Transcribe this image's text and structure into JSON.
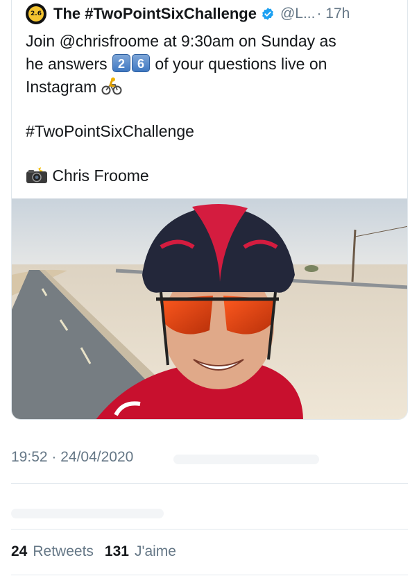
{
  "tweet": {
    "avatar_text": "2.6",
    "display_name": "The #TwoPointSixChallenge",
    "handle": "@L...",
    "time": "· 17h",
    "text": {
      "line1": "Join @chrisfroome at 9:30am on Sunday as",
      "line2_a": "he answers",
      "key1": "2",
      "key2": "6",
      "line2_b": "of your questions live on",
      "line3": "Instagram",
      "hashtag": "#TwoPointSixChallenge",
      "credit": "Chris Froome"
    },
    "icons": {
      "avatar": "challenge-logo-icon",
      "verified": "verified-badge-icon",
      "bike": "cyclist-emoji-icon",
      "camera": "camera-flash-emoji-icon"
    }
  },
  "meta": {
    "timestamp": "19:52 · 24/04/2020"
  },
  "stats": {
    "retweets_count": "24",
    "retweets_label": "Retweets",
    "likes_count": "131",
    "likes_label": "J'aime"
  },
  "colors": {
    "text": "#14171a",
    "secondary": "#657786",
    "verified": "#1da1f2",
    "divider": "#e1e8ed",
    "jersey": "#c8102e"
  }
}
